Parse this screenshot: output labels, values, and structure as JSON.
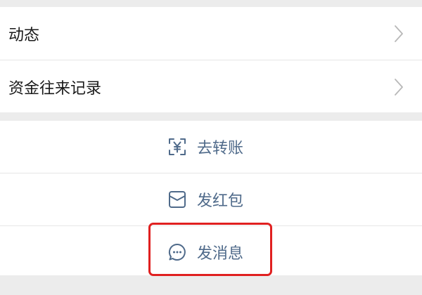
{
  "menu": {
    "items": [
      {
        "label": "动态",
        "icon": "chevron-right-icon"
      },
      {
        "label": "资金往来记录",
        "icon": "chevron-right-icon"
      }
    ]
  },
  "actions": {
    "items": [
      {
        "label": "去转账",
        "icon": "yuan-transfer-icon"
      },
      {
        "label": "发红包",
        "icon": "red-envelope-icon"
      },
      {
        "label": "发消息",
        "icon": "chat-bubble-icon"
      }
    ]
  },
  "highlight": {
    "target": "发消息",
    "color": "#e02020"
  },
  "colors": {
    "action_accent": "#4f6a8a",
    "background": "#ececec"
  }
}
